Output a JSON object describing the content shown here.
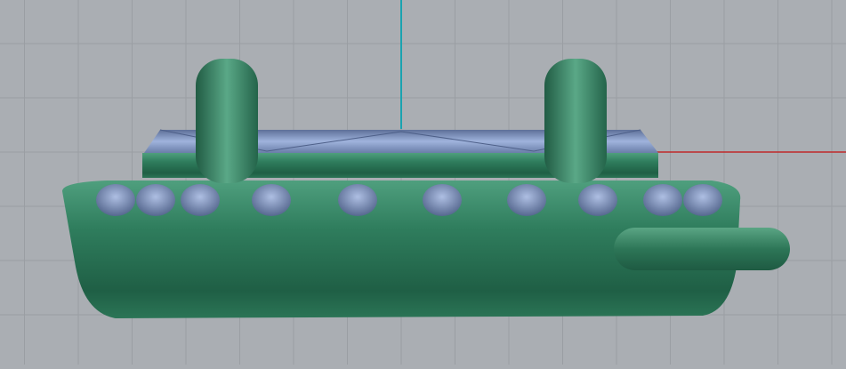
{
  "viewport": {
    "background_color": "#aaaeb3",
    "grid_color": "#9a9ea3",
    "x_axis_color": "#c0282a",
    "z_axis_color": "#1aa3b0",
    "metal_color": "#2f7a5c",
    "gem_color": "#7f93bf"
  }
}
